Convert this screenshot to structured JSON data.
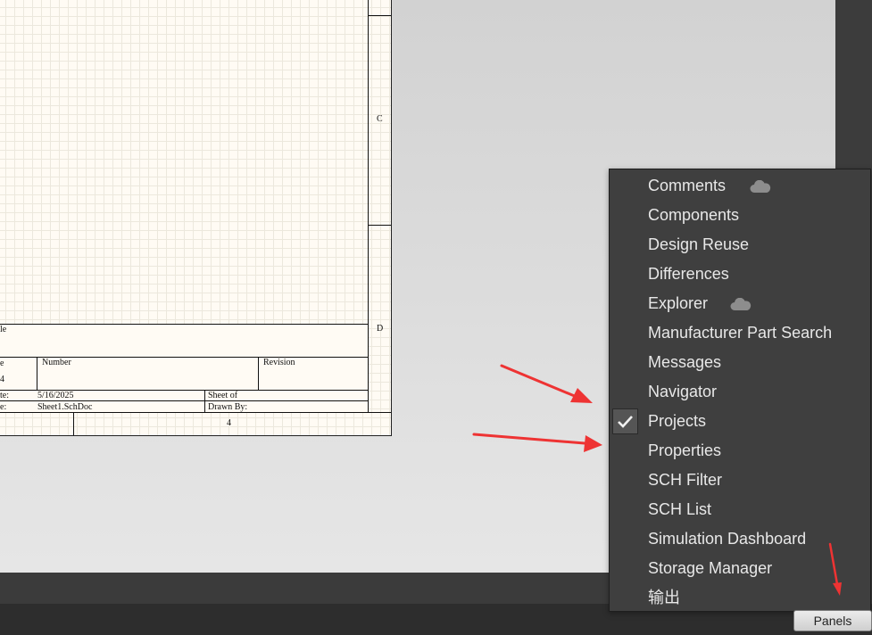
{
  "schematic": {
    "zone_c": "C",
    "zone_d": "D",
    "title_block": {
      "title_partial": "le",
      "size_partial": "e",
      "size_value_partial": "4",
      "number_label": "Number",
      "revision_label": "Revision",
      "date_label_partial": "te:",
      "date_value": "5/16/2025",
      "file_label_partial": "e:",
      "file_value": "Sheet1.SchDoc",
      "sheet_label": "Sheet   of",
      "drawn_by_label": "Drawn By:",
      "column_number": "4"
    }
  },
  "panels_menu": {
    "items": [
      {
        "label": "Comments",
        "checked": false,
        "cloud": true
      },
      {
        "label": "Components",
        "checked": false,
        "cloud": false
      },
      {
        "label": "Design Reuse",
        "checked": false,
        "cloud": false
      },
      {
        "label": "Differences",
        "checked": false,
        "cloud": false
      },
      {
        "label": "Explorer",
        "checked": false,
        "cloud": true
      },
      {
        "label": "Manufacturer Part Search",
        "checked": false,
        "cloud": false
      },
      {
        "label": "Messages",
        "checked": false,
        "cloud": false
      },
      {
        "label": "Navigator",
        "checked": false,
        "cloud": false
      },
      {
        "label": "Projects",
        "checked": true,
        "cloud": false
      },
      {
        "label": "Properties",
        "checked": false,
        "cloud": false
      },
      {
        "label": "SCH Filter",
        "checked": false,
        "cloud": false
      },
      {
        "label": "SCH List",
        "checked": false,
        "cloud": false
      },
      {
        "label": "Simulation Dashboard",
        "checked": false,
        "cloud": false
      },
      {
        "label": "Storage Manager",
        "checked": false,
        "cloud": false
      },
      {
        "label": "输出",
        "checked": false,
        "cloud": false
      }
    ]
  },
  "status_bar": {
    "panels_button_label": "Panels"
  },
  "annotation_color": "#ee3333"
}
